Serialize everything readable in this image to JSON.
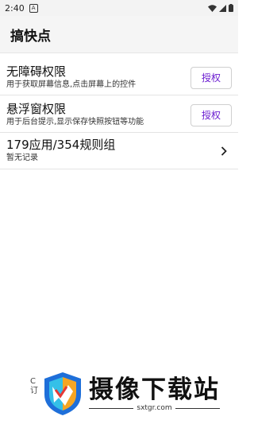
{
  "status": {
    "time": "2:40",
    "notif_glyph": "A"
  },
  "app": {
    "title": "搞快点"
  },
  "permissions": [
    {
      "title": "无障碍权限",
      "desc": "用于获取屏幕信息,点击屏幕上的控件",
      "button": "授权"
    },
    {
      "title": "悬浮窗权限",
      "desc": "用于后台提示,显示保存快照按钮等功能",
      "button": "授权"
    }
  ],
  "rules": {
    "title": "179应用/354规则组",
    "subtitle": "暂无记录"
  },
  "footer": {
    "hint_line1": "C",
    "hint_line2": "订"
  },
  "watermark": {
    "text": "摄像下载站",
    "url": "sxtgr.com"
  },
  "colors": {
    "accent": "#6a1bd0"
  }
}
